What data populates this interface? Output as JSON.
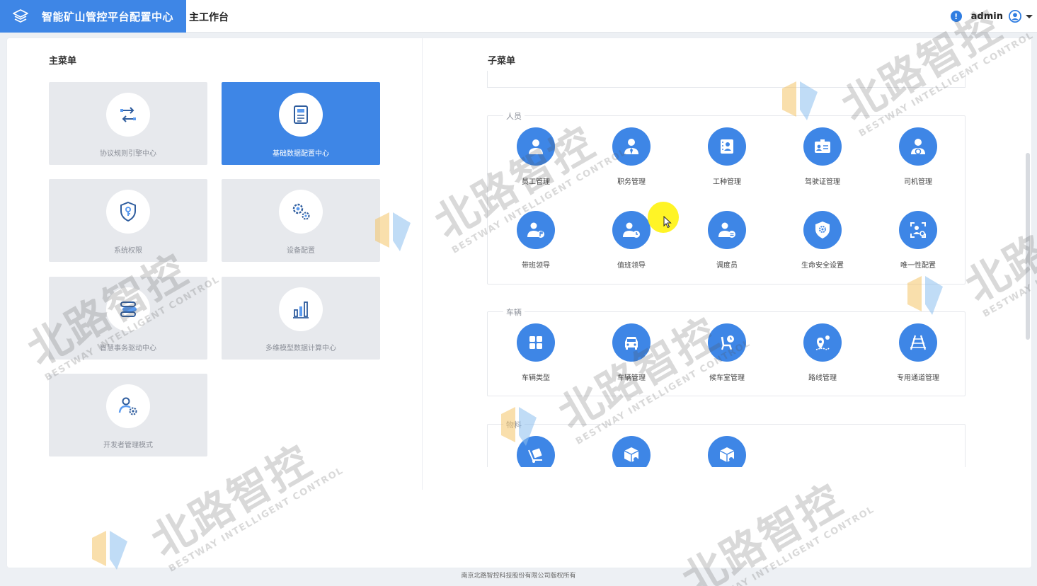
{
  "header": {
    "app_title": "智能矿山管控平台配置中心",
    "nav_tab": "主工作台",
    "notify_badge": "!",
    "username": "admin",
    "icons": [
      "stack-layers-icon",
      "user-avatar-icon",
      "caret-down-icon"
    ]
  },
  "main_menu": {
    "title": "主菜单",
    "items": [
      {
        "label": "协议规则引擎中心",
        "icon": "swap-arrows-icon",
        "active": false
      },
      {
        "label": "基础数据配置中心",
        "icon": "document-icon",
        "active": true
      },
      {
        "label": "系统权限",
        "icon": "shield-key-icon",
        "active": false
      },
      {
        "label": "设备配置",
        "icon": "gears-icon",
        "active": false
      },
      {
        "label": "智慧事务驱动中心",
        "icon": "capsule-flow-icon",
        "active": false
      },
      {
        "label": "多维模型数据计算中心",
        "icon": "bar-chart-icon",
        "active": false
      },
      {
        "label": "开发者管理模式",
        "icon": "user-gear-icon",
        "active": false
      }
    ]
  },
  "sub_menu": {
    "title": "子菜单",
    "groups": [
      {
        "name": "人员",
        "items": [
          {
            "label": "员工管理",
            "icon": "employee-icon"
          },
          {
            "label": "职务管理",
            "icon": "tie-user-icon"
          },
          {
            "label": "工种管理",
            "icon": "id-book-icon"
          },
          {
            "label": "驾驶证管理",
            "icon": "license-card-icon"
          },
          {
            "label": "司机管理",
            "icon": "driver-icon"
          },
          {
            "label": "带班领导",
            "icon": "leader-flag-icon"
          },
          {
            "label": "值班领导",
            "icon": "leader-clock-icon"
          },
          {
            "label": "调度员",
            "icon": "dispatcher-icon"
          },
          {
            "label": "生命安全设置",
            "icon": "safety-shield-icon"
          },
          {
            "label": "唯一性配置",
            "icon": "face-scan-icon"
          }
        ]
      },
      {
        "name": "车辆",
        "items": [
          {
            "label": "车辆类型",
            "icon": "grid-apps-icon"
          },
          {
            "label": "车辆管理",
            "icon": "car-front-icon"
          },
          {
            "label": "候车室管理",
            "icon": "waiting-seat-icon"
          },
          {
            "label": "路线管理",
            "icon": "route-pin-icon"
          },
          {
            "label": "专用通道管理",
            "icon": "road-lanes-icon"
          }
        ]
      },
      {
        "name": "物料",
        "items": [
          {
            "label": "",
            "icon": "hand-truck-icon"
          },
          {
            "label": "",
            "icon": "box-gear-icon"
          },
          {
            "label": "",
            "icon": "box-list-icon"
          }
        ]
      }
    ]
  },
  "watermark": {
    "cn": "北路智控",
    "en": "BESTWAY INTELLIGENT CONTROL"
  },
  "footer": {
    "copyright": "南京北路智控科技股份有限公司版权所有"
  },
  "colors": {
    "primary": "#3e86e6",
    "card_bg": "#e7e9ed",
    "page_bg": "#edf0f4",
    "highlight": "#fff200"
  }
}
